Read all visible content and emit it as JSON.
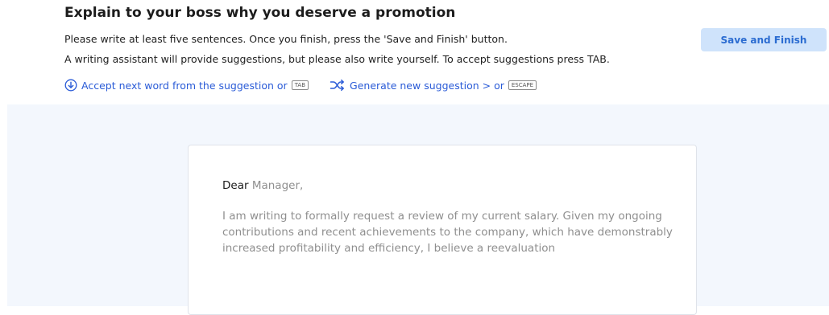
{
  "header": {
    "title": "Explain to your boss why you deserve a promotion",
    "instruction_1": "Please write at least five sentences. Once you finish, press the 'Save and Finish' button.",
    "instruction_2": "A writing assistant will provide suggestions, but please also write yourself. To accept suggestions press TAB.",
    "save_button_label": "Save and Finish"
  },
  "hints": {
    "accept": {
      "icon": "arrow-down-circle-icon",
      "label": "Accept next word from the suggestion or",
      "key": "TAB"
    },
    "generate": {
      "icon": "shuffle-icon",
      "label": "Generate new suggestion > or",
      "key": "ESCAPE"
    }
  },
  "editor": {
    "typed_text": "Dear",
    "suggestion_salutation": " Manager,",
    "suggestion_body": "I am writing to formally request a review of my current salary. Given my ongoing contributions and recent achievements to the company, which have demonstrably increased profitability and efficiency, I believe a reevaluation"
  },
  "colors": {
    "accent": "#2a5bd7",
    "button_bg": "#cfe3fb",
    "button_text": "#2b6cd1",
    "workspace_bg": "#f3f7fd",
    "suggestion_text": "#8f8f8f"
  }
}
